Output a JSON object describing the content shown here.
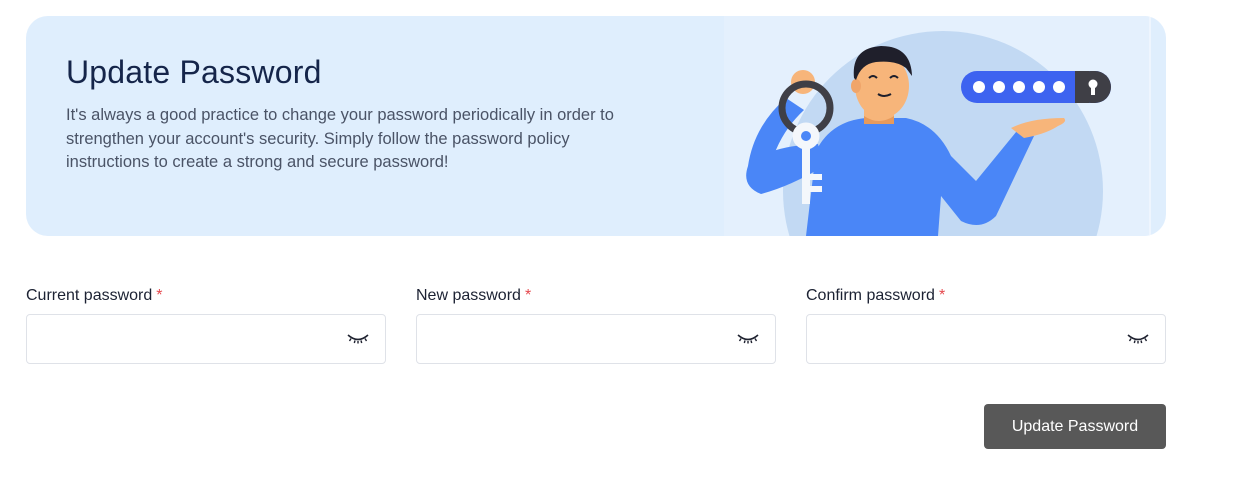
{
  "banner": {
    "title": "Update Password",
    "description": "It's always a good practice to change your password periodically in order to strengthen your account's security. Simply follow the password policy instructions to create a strong and secure password!"
  },
  "form": {
    "fields": [
      {
        "label": "Current password",
        "required_mark": "*",
        "value": "",
        "toggle_icon": "eye-closed-icon"
      },
      {
        "label": "New password",
        "required_mark": "*",
        "value": "",
        "toggle_icon": "eye-closed-icon"
      },
      {
        "label": "Confirm password",
        "required_mark": "*",
        "value": "",
        "toggle_icon": "eye-closed-icon"
      }
    ],
    "submit_label": "Update Password"
  },
  "colors": {
    "banner_bg": "#dfeefd",
    "title": "#15254a",
    "required": "#e5484d",
    "button_bg": "#585858",
    "illustration_accent": "#4a86f7",
    "illustration_circle": "#c2d9f3",
    "password_pill": "#3d63f0"
  }
}
